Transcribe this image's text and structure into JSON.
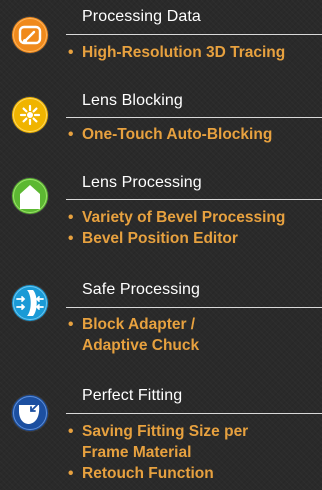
{
  "features": [
    {
      "title": "Processing Data",
      "icon": "tracing-icon",
      "icon_color": "#f08a1c",
      "bullets": [
        {
          "lines": [
            "High-Resolution 3D Tracing"
          ]
        }
      ]
    },
    {
      "title": "Lens Blocking",
      "icon": "blocking-icon",
      "icon_color": "#f0b400",
      "bullets": [
        {
          "lines": [
            "One-Touch Auto-Blocking"
          ]
        }
      ]
    },
    {
      "title": "Lens Processing",
      "icon": "bevel-icon",
      "icon_color": "#5cb832",
      "bullets": [
        {
          "lines": [
            "Variety of Bevel Processing"
          ]
        },
        {
          "lines": [
            "Bevel Position Editor"
          ]
        }
      ]
    },
    {
      "title": "Safe Processing",
      "icon": "chuck-icon",
      "icon_color": "#1a9ad6",
      "bullets": [
        {
          "lines": [
            "Block Adapter /",
            "Adaptive Chuck"
          ]
        }
      ]
    },
    {
      "title": "Perfect Fitting",
      "icon": "fitting-icon",
      "icon_color": "#1c4fa0",
      "bullets": [
        {
          "lines": [
            "Saving Fitting Size per",
            "Frame Material"
          ]
        },
        {
          "lines": [
            "Retouch Function"
          ]
        }
      ]
    }
  ]
}
